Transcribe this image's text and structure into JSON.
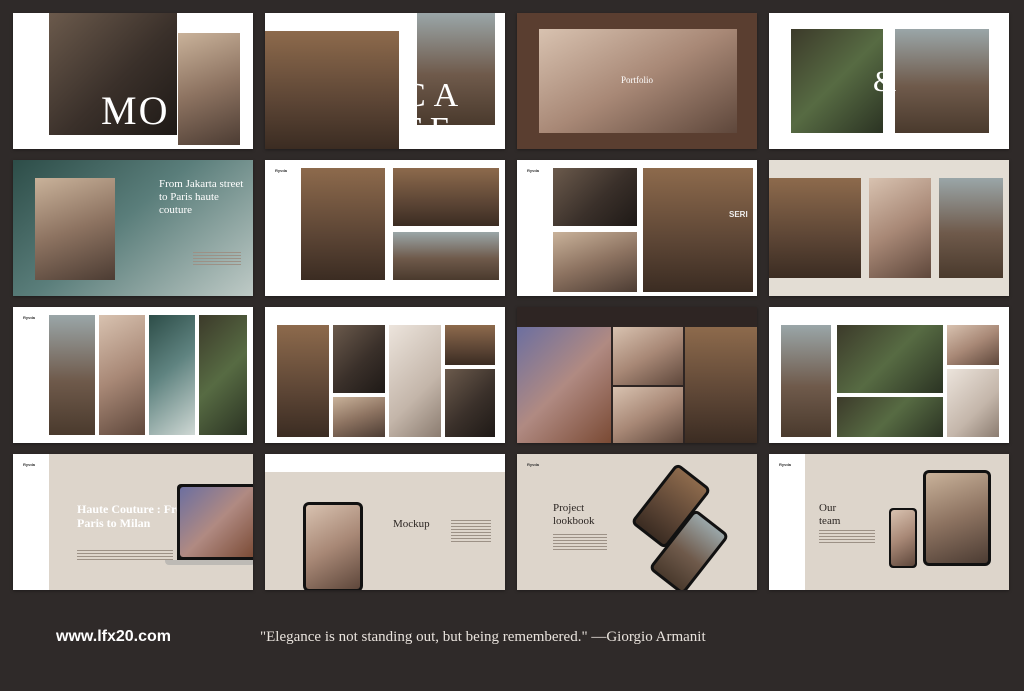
{
  "slides": {
    "mood_word": "MOOD",
    "cafe_word": "CAFE",
    "portfolio_label": "Portfolio",
    "ampersand": "&",
    "jakarta_heading": "From Jakarta street to Paris haute couture",
    "haute_heading": "Haute Couture : From Paris to Milan",
    "mockup_heading": "Mockup",
    "project_heading": "Project lookbook",
    "team_heading": "Our team",
    "cafe_sign": "SERI"
  },
  "footer": {
    "url": "www.lfx20.com",
    "quote": "\"Elegance is not standing out, but being remembered.\" —Giorgio Armanit"
  }
}
